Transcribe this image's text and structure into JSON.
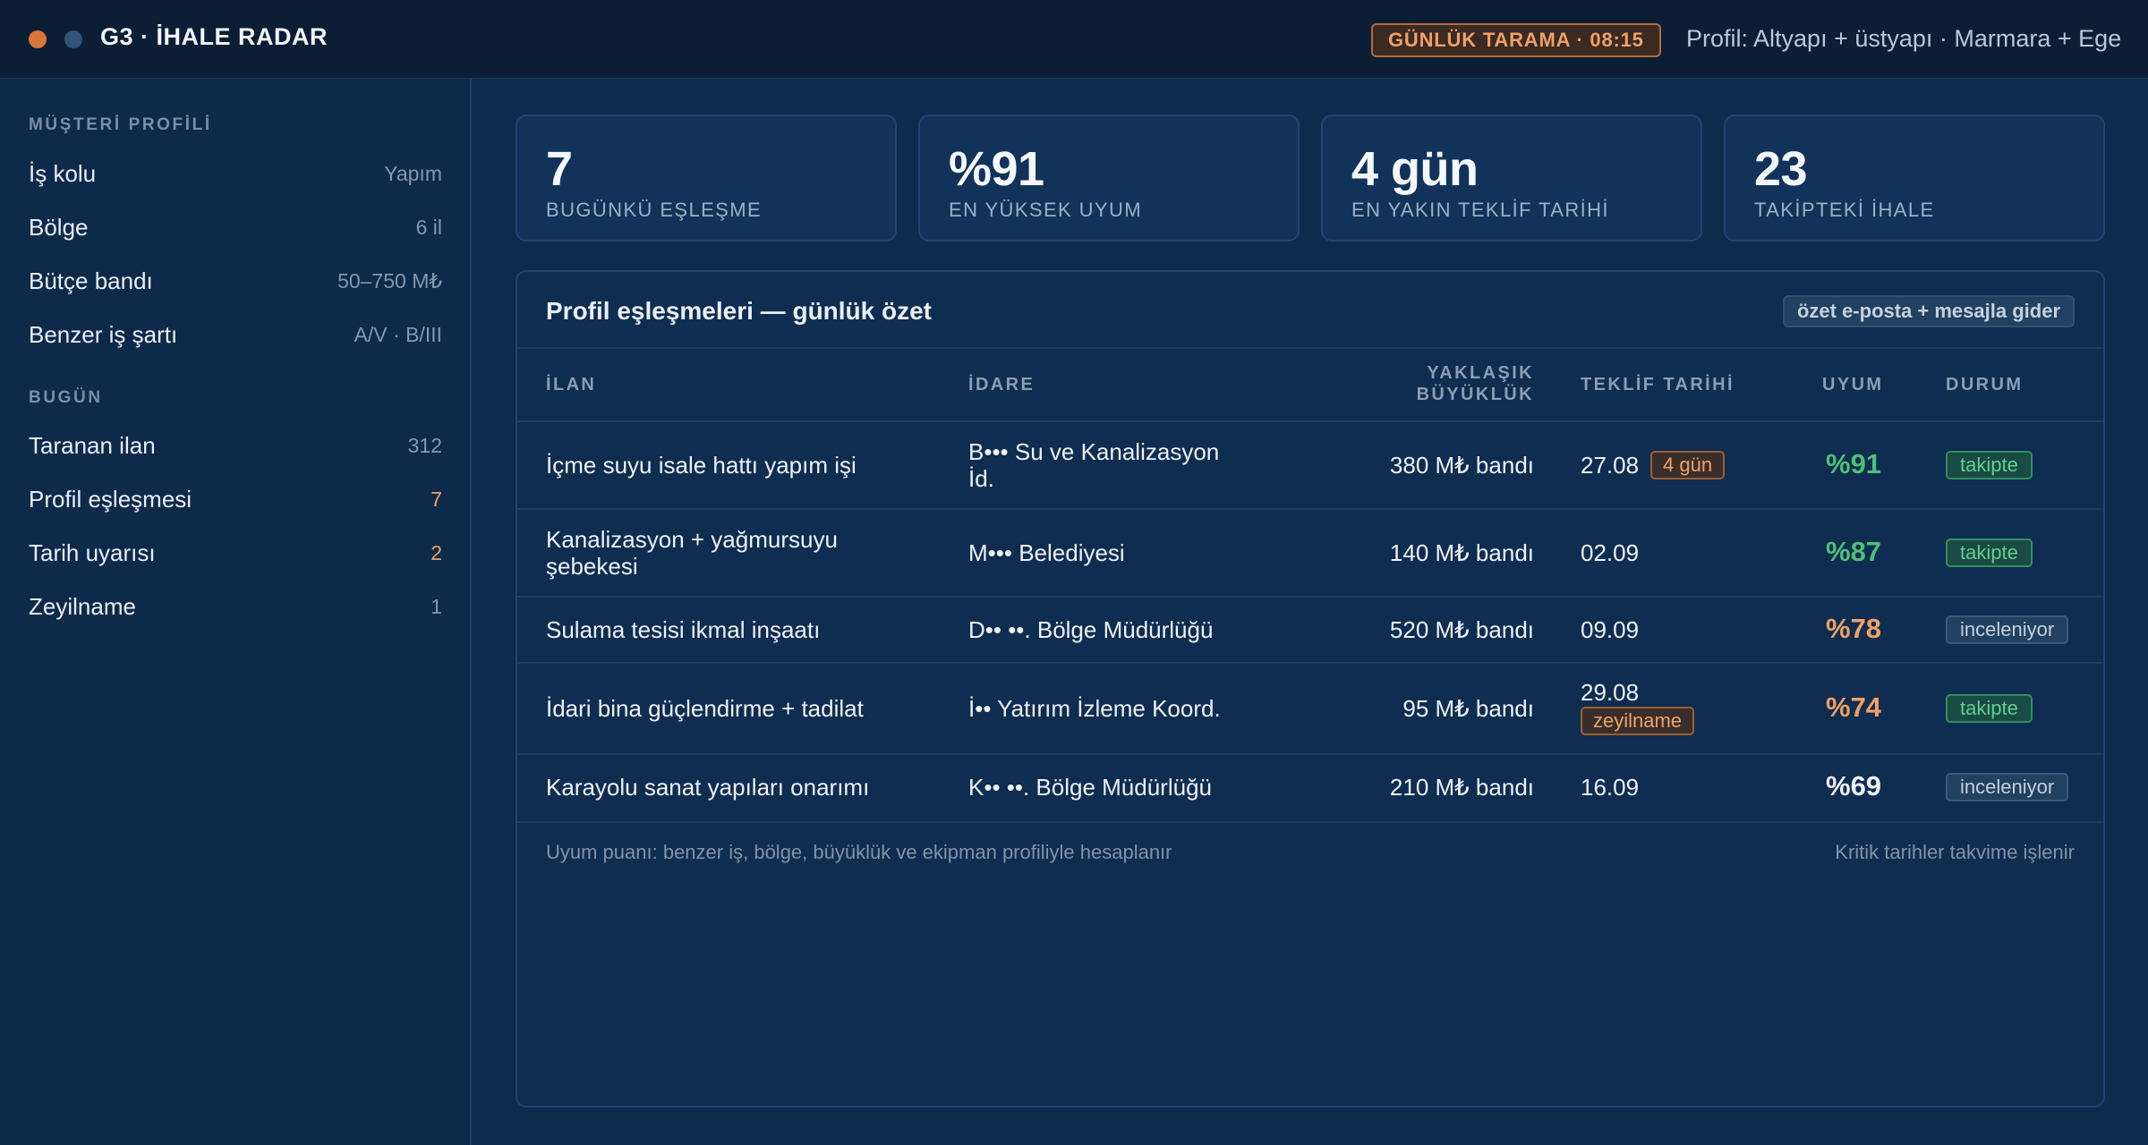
{
  "app": {
    "title": "G3 · İHALE RADAR",
    "scan_badge": "GÜNLÜK TARAMA · 08:15",
    "profile_text": "Profil: Altyapı + üstyapı · Marmara + Ege",
    "colors": {
      "accent": "#f0a066",
      "success": "#4fbf78",
      "background": "#0c2c4e"
    }
  },
  "sidebar": {
    "profile_heading": "MÜŞTERİ PROFİLİ",
    "profile_rows": [
      {
        "label": "İş kolu",
        "value": "Yapım"
      },
      {
        "label": "Bölge",
        "value": "6 il"
      },
      {
        "label": "Bütçe bandı",
        "value": "50–750 M₺"
      },
      {
        "label": "Benzer iş şartı",
        "value": "A/V · B/III"
      }
    ],
    "today_heading": "BUGÜN",
    "today_rows": [
      {
        "label": "Taranan ilan",
        "value": "312"
      },
      {
        "label": "Profil eşleşmesi",
        "value": "7"
      },
      {
        "label": "Tarih uyarısı",
        "value": "2"
      },
      {
        "label": "Zeyilname",
        "value": "1"
      }
    ]
  },
  "stats": [
    {
      "value": "7",
      "label": "BUGÜNKÜ EŞLEŞME"
    },
    {
      "value": "%91",
      "label": "EN YÜKSEK UYUM"
    },
    {
      "value": "4 gün",
      "label": "EN YAKIN TEKLİF TARİHİ"
    },
    {
      "value": "23",
      "label": "TAKİPTEKİ İHALE"
    }
  ],
  "panel": {
    "title": "Profil eşleşmeleri — günlük özet",
    "pill": "özet e-posta + mesajla gider",
    "columns": {
      "ilan": "İLAN",
      "idare": "İDARE",
      "size_line1": "YAKLAŞIK",
      "size_line2": "BÜYÜKLÜK",
      "date": "TEKLİF TARİHİ",
      "uyum": "UYUM",
      "status": "DURUM"
    },
    "rows": [
      {
        "ilan_1": "İçme suyu isale hattı yapım işi",
        "ilan_2": "",
        "idare_1": "B••• Su ve Kanalizasyon",
        "idare_2": "İd.",
        "size": "380 M₺ bandı",
        "date": "27.08",
        "chip": "4 gün",
        "uyum": "%91",
        "status": "takipte"
      },
      {
        "ilan_1": "Kanalizasyon + yağmursuyu",
        "ilan_2": "şebekesi",
        "idare_1": "M••• Belediyesi",
        "idare_2": "",
        "size": "140 M₺ bandı",
        "date": "02.09",
        "chip": "",
        "uyum": "%87",
        "status": "takipte"
      },
      {
        "ilan_1": "Sulama tesisi ikmal inşaatı",
        "ilan_2": "",
        "idare_1": "D•• ••. Bölge Müdürlüğü",
        "idare_2": "",
        "size": "520 M₺ bandı",
        "date": "09.09",
        "chip": "",
        "uyum": "%78",
        "status": "inceleniyor"
      },
      {
        "ilan_1": "İdari bina güçlendirme + tadilat",
        "ilan_2": "",
        "idare_1": "İ•• Yatırım İzleme Koord.",
        "idare_2": "",
        "size": "95 M₺ bandı",
        "date": "29.08",
        "chip": "zeyilname",
        "uyum": "%74",
        "status": "takipte"
      },
      {
        "ilan_1": "Karayolu sanat yapıları onarımı",
        "ilan_2": "",
        "idare_1": "K•• ••. Bölge Müdürlüğü",
        "idare_2": "",
        "size": "210 M₺ bandı",
        "date": "16.09",
        "chip": "",
        "uyum": "%69",
        "status": "inceleniyor"
      }
    ],
    "footer_left": "Uyum puanı: benzer iş, bölge, büyüklük ve ekipman profiliyle hesaplanır",
    "footer_right": "Kritik tarihler takvime işlenir"
  }
}
